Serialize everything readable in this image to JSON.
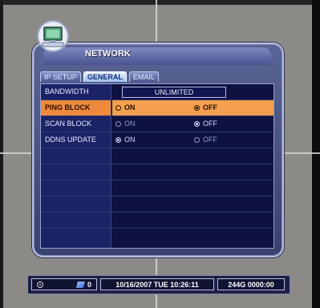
{
  "window": {
    "title": "NETWORK",
    "logo_icon": "network-computer-icon"
  },
  "tabs": [
    {
      "label": "IP SETUP",
      "active": false
    },
    {
      "label": "GENERAL",
      "active": true
    },
    {
      "label": "EMAIL",
      "active": false
    }
  ],
  "rows": {
    "bandwidth": {
      "label": "BANDWIDTH",
      "value": "UNLIMITED"
    },
    "ping_block": {
      "label": "PING BLOCK",
      "on_label": "ON",
      "off_label": "OFF",
      "selected": "OFF"
    },
    "scan_block": {
      "label": "SCAN BLOCK",
      "on_label": "ON",
      "off_label": "OFF",
      "selected": "OFF"
    },
    "ddns_update": {
      "label": "DDNS UPDATE",
      "on_label": "ON",
      "off_label": "OFF",
      "selected": "ON"
    }
  },
  "statusbar": {
    "record_icon": "record-icon",
    "disk_count": "0",
    "datetime": "10/16/2007 TUE 10:26:11",
    "storage": "244G 0000:00"
  },
  "colors": {
    "highlight": "#f4a04e",
    "panel": "#0d1240",
    "accent": "#ef8a3c"
  }
}
